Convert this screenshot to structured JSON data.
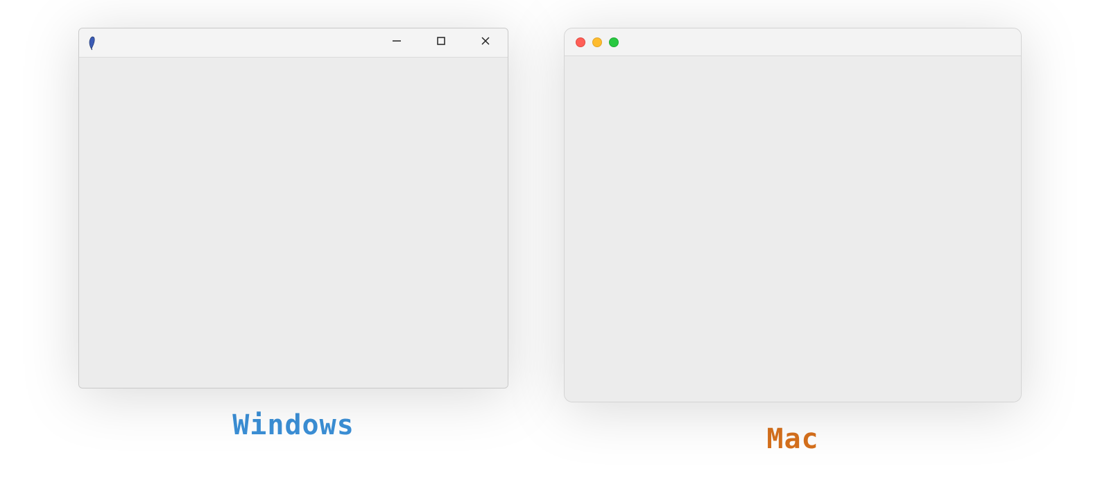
{
  "windows": {
    "caption": "Windows",
    "caption_color": "#3b8fd6",
    "app_icon": "feather-icon",
    "controls": {
      "minimize": "minimize-icon",
      "maximize": "maximize-icon",
      "close": "close-icon"
    }
  },
  "mac": {
    "caption": "Mac",
    "caption_color": "#d6701c",
    "traffic_lights": {
      "close": "#ff5f57",
      "minimize": "#febc2e",
      "zoom": "#28c840"
    }
  }
}
